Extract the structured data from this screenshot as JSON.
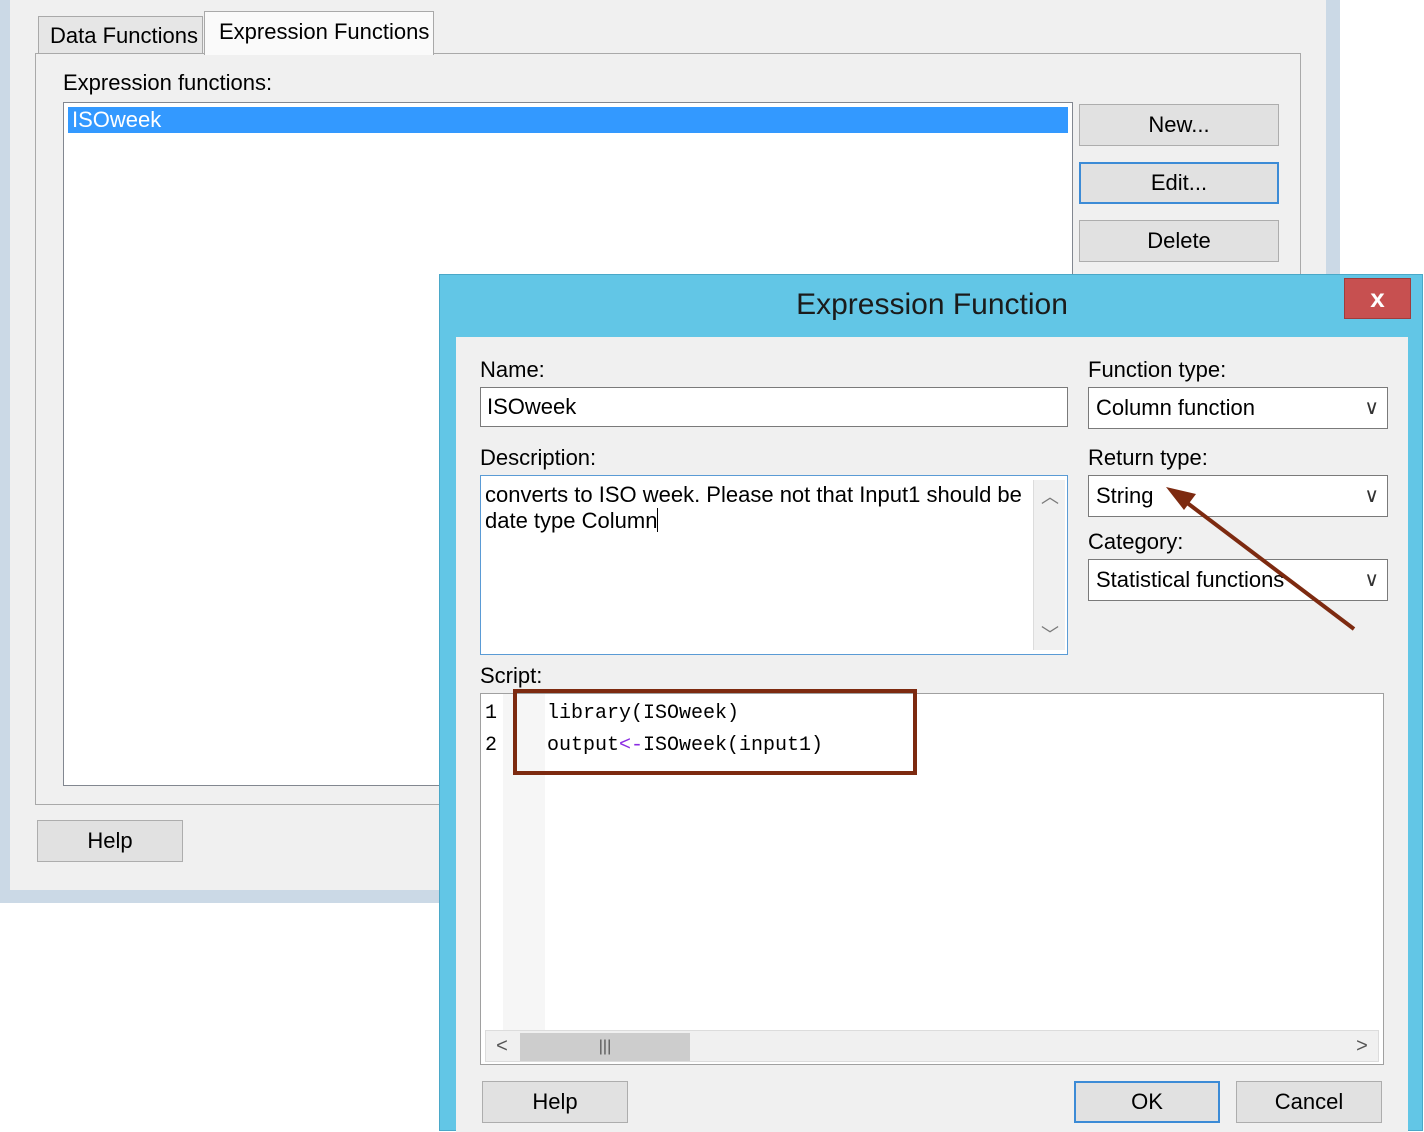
{
  "parent": {
    "tabs": [
      "Data Functions",
      "Expression Functions"
    ],
    "list_label": "Expression functions:",
    "list_items": [
      "ISOweek"
    ],
    "buttons": {
      "new": "New...",
      "edit": "Edit...",
      "delete": "Delete",
      "help": "Help"
    }
  },
  "dialog": {
    "title": "Expression Function",
    "close_glyph": "x",
    "name": {
      "label": "Name:",
      "value": "ISOweek"
    },
    "description": {
      "label": "Description:",
      "value": "converts to ISO week. Please not that Input1 should be date type Column"
    },
    "function_type": {
      "label": "Function type:",
      "value": "Column function"
    },
    "return_type": {
      "label": "Return type:",
      "value": "String"
    },
    "category": {
      "label": "Category:",
      "value": "Statistical functions"
    },
    "script": {
      "label": "Script:",
      "line_numbers": [
        "1",
        "2"
      ],
      "line1": "library(ISOweek)",
      "line2_a": "output",
      "line2_op": "<-",
      "line2_b": "ISOweek(input1)"
    },
    "buttons": {
      "help": "Help",
      "ok": "OK",
      "cancel": "Cancel"
    }
  },
  "colors": {
    "dialog_frame": "#62c6e6",
    "selection": "#3399ff",
    "annotation": "#7d2a10",
    "close_button": "#c75050"
  },
  "icons": [
    "chevron-down-icon",
    "scroll-up-icon",
    "scroll-down-icon",
    "scroll-left-icon",
    "scroll-right-icon",
    "close-icon"
  ]
}
